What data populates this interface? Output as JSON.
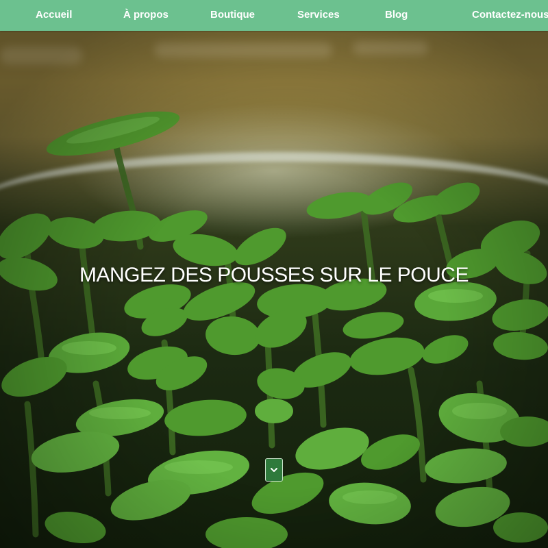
{
  "nav": {
    "items": [
      {
        "label": "Accueil"
      },
      {
        "label": "À propos"
      },
      {
        "label": "Boutique"
      },
      {
        "label": "Services"
      },
      {
        "label": "Blog"
      },
      {
        "label": "Contactez-nous"
      }
    ]
  },
  "hero": {
    "title": "MANGEZ DES POUSSES SUR LE POUCE",
    "scroll_icon": "chevron-down-icon"
  },
  "colors": {
    "nav_background": "#6cc18f",
    "nav_text": "#ffffff",
    "scroll_button": "#2f7a3c"
  }
}
